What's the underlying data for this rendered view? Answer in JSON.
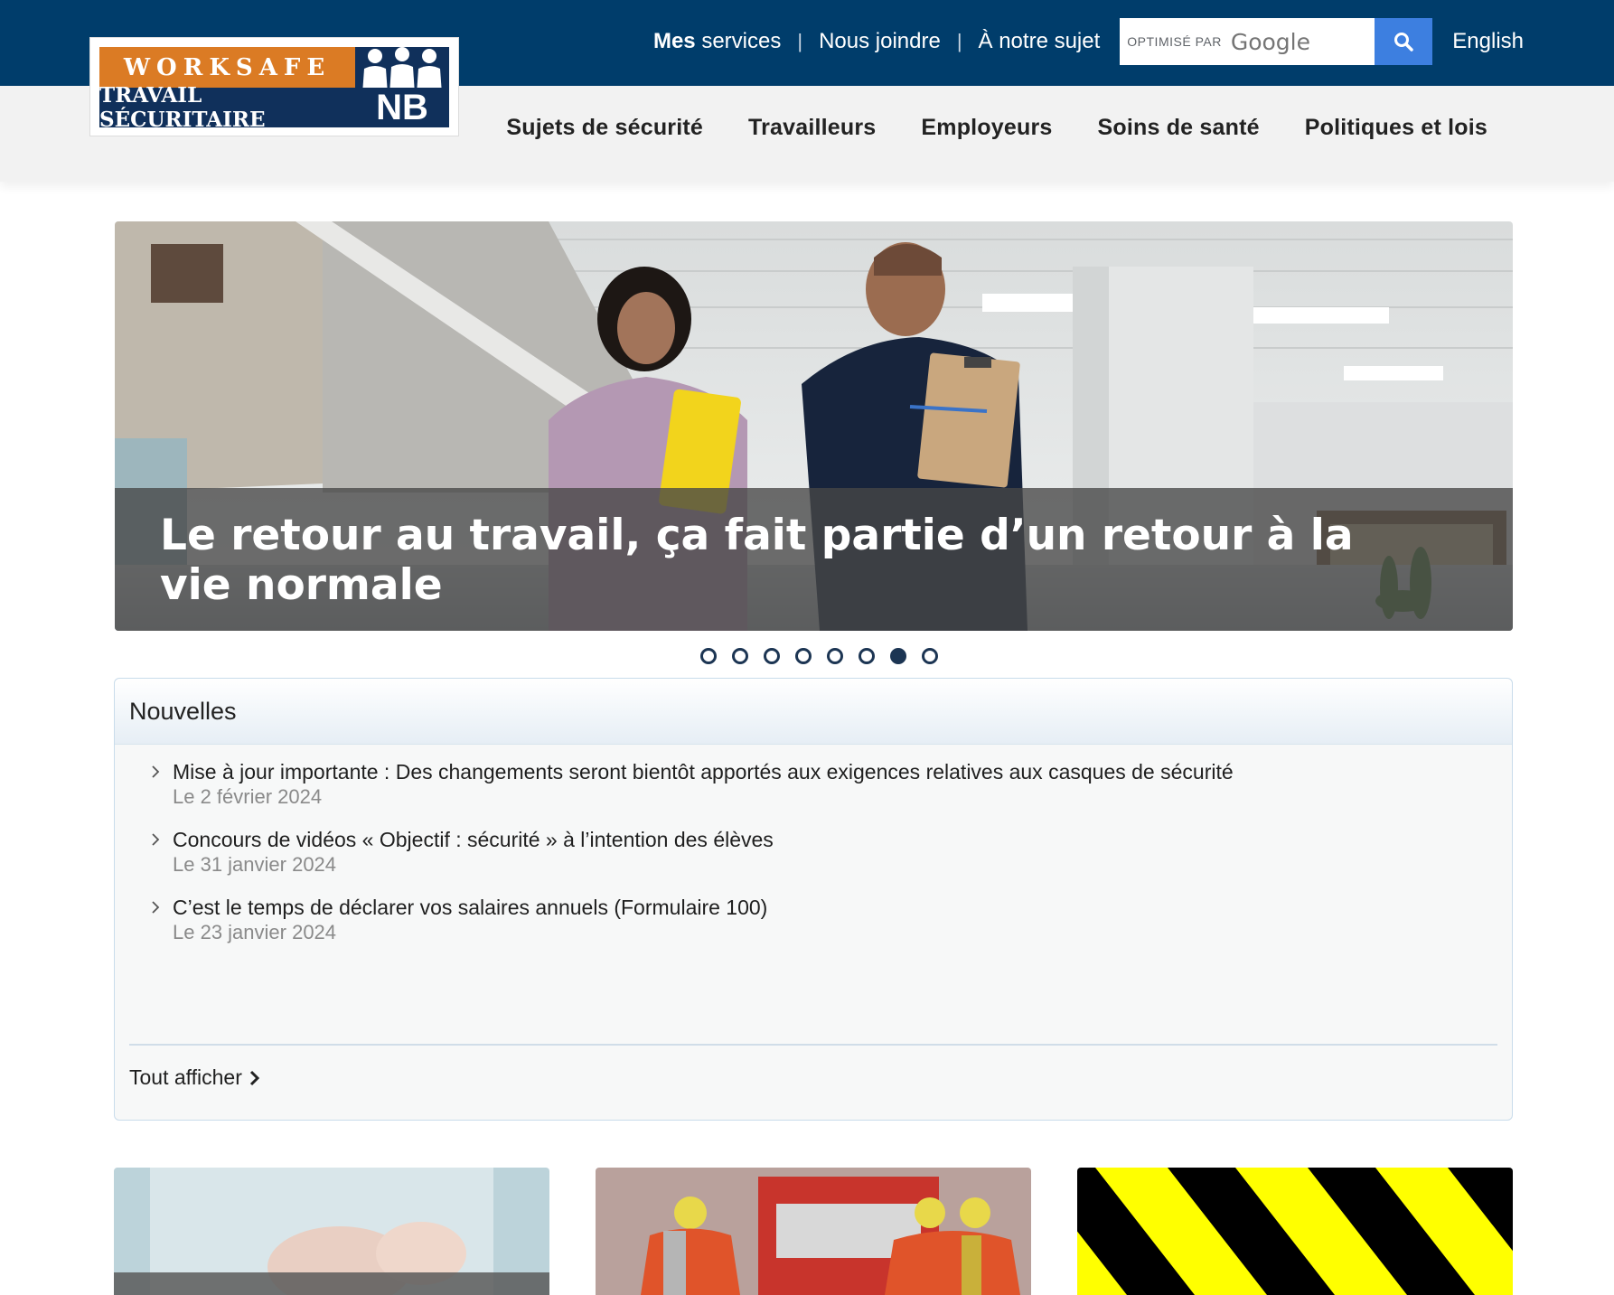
{
  "header": {
    "utility_links": [
      {
        "strong": "Mes",
        "rest": " services"
      },
      {
        "label": "Nous joindre"
      },
      {
        "label": "À notre sujet"
      }
    ],
    "separator": "|",
    "search": {
      "powered_by": "OPTIMISÉ PAR",
      "brand": "Google"
    },
    "language_link": "English"
  },
  "logo": {
    "line1": "WORKSAFE",
    "line2": "TRAVAIL SÉCURITAIRE",
    "badge": "NB"
  },
  "nav": {
    "items": [
      "Sujets de sécurité",
      "Travailleurs",
      "Employeurs",
      "Soins de santé",
      "Politiques et lois"
    ]
  },
  "hero": {
    "caption": "Le retour au travail, ça fait partie d’un retour à la vie normale",
    "slide_count": 8,
    "active_slide": 7
  },
  "news": {
    "title": "Nouvelles",
    "items": [
      {
        "title": "Mise à jour importante : Des changements seront bientôt apportés aux exigences relatives aux casques de sécurité",
        "date": "Le 2 février 2024"
      },
      {
        "title": "Concours de vidéos « Objectif : sécurité » à l’intention des élèves",
        "date": "Le 31 janvier 2024"
      },
      {
        "title": "C’est le temps de déclarer vos salaires annuels (Formulaire 100)",
        "date": "Le 23 janvier 2024"
      }
    ],
    "view_all": "Tout afficher"
  },
  "colors": {
    "header_blue": "#003d6b",
    "logo_orange": "#db7b24",
    "logo_navy": "#10305b",
    "search_button": "#3d7fe0",
    "hazard_yellow": "#ffff00"
  }
}
